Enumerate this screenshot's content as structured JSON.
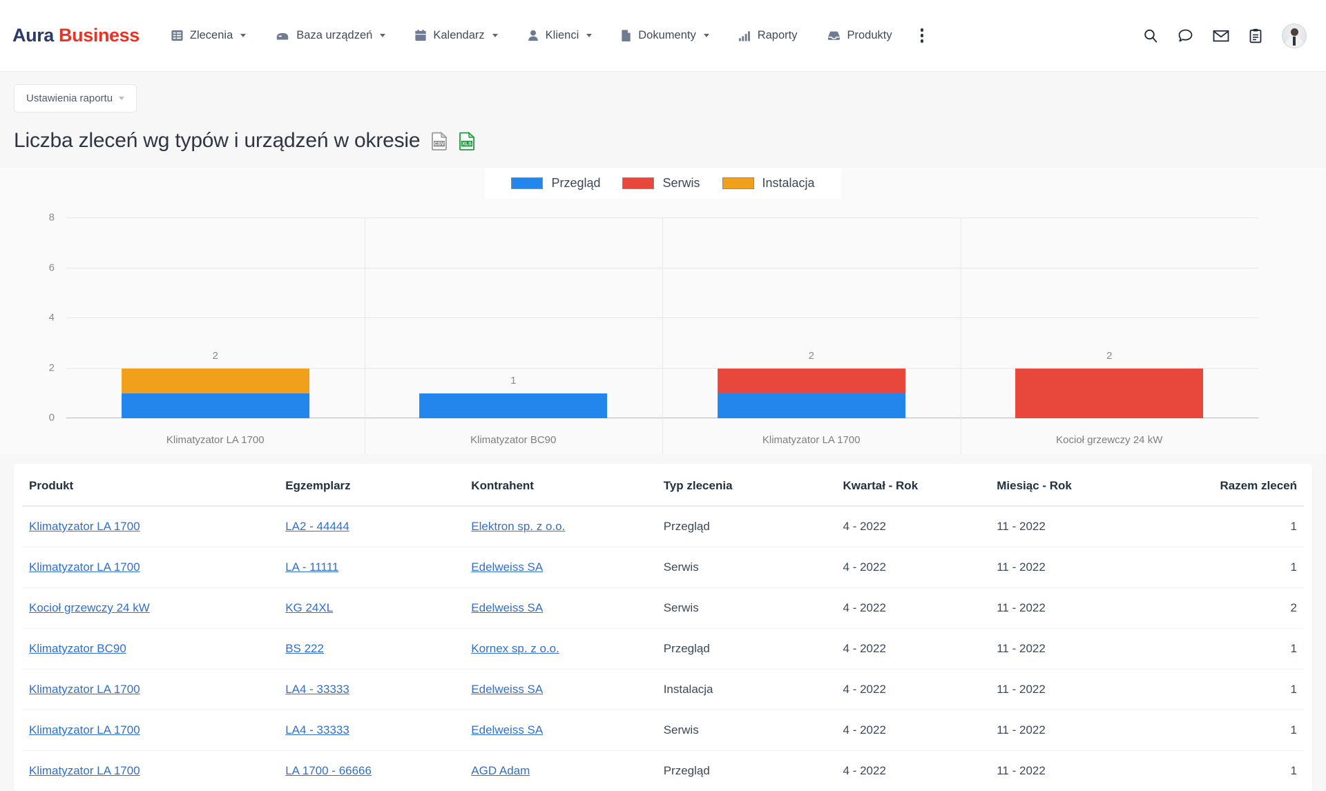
{
  "app": {
    "logo_primary": "Aura",
    "logo_secondary": "Business",
    "logo_primary_color": "#2b3a67",
    "logo_secondary_color": "#ee3124"
  },
  "nav": {
    "items": [
      {
        "label": "Zlecenia",
        "icon": "list-icon",
        "has_caret": true
      },
      {
        "label": "Baza urządzeń",
        "icon": "device-icon",
        "has_caret": true
      },
      {
        "label": "Kalendarz",
        "icon": "calendar-icon",
        "has_caret": true
      },
      {
        "label": "Klienci",
        "icon": "person-icon",
        "has_caret": true
      },
      {
        "label": "Dokumenty",
        "icon": "document-icon",
        "has_caret": true
      },
      {
        "label": "Raporty",
        "icon": "bar-chart-icon",
        "has_caret": false
      },
      {
        "label": "Produkty",
        "icon": "inbox-icon",
        "has_caret": false
      }
    ],
    "overflow_icon": "kebab-menu-icon",
    "right_icons": [
      "search-icon",
      "chat-bubble-icon",
      "envelope-icon",
      "clipboard-icon"
    ],
    "avatar": "user-avatar"
  },
  "toolbar": {
    "report_settings_label": "Ustawienia raportu"
  },
  "report": {
    "title": "Liczba zleceń wg typów i urządzeń w okresie",
    "export_csv_icon": "csv-file-icon",
    "export_xls_icon": "xls-file-icon"
  },
  "chart_data": {
    "type": "bar",
    "stacked": true,
    "title": "Liczba zleceń wg typów i urządzeń w okresie",
    "xlabel": "",
    "ylabel": "",
    "ylim": [
      0,
      8
    ],
    "yticks": [
      0,
      2,
      4,
      6,
      8
    ],
    "grid": true,
    "legend_position": "top-center",
    "categories": [
      "Klimatyzator LA 1700",
      "Klimatyzator BC90",
      "Klimatyzator LA 1700",
      "Kocioł grzewczy 24 kW"
    ],
    "series": [
      {
        "name": "Przegląd",
        "color": "#2286ec",
        "values": [
          1,
          1,
          1,
          0
        ]
      },
      {
        "name": "Serwis",
        "color": "#e8483c",
        "values": [
          0,
          0,
          1,
          2
        ]
      },
      {
        "name": "Instalacja",
        "color": "#f0a01b",
        "values": [
          1,
          0,
          0,
          0
        ]
      }
    ],
    "totals": [
      2,
      1,
      2,
      2
    ]
  },
  "table": {
    "columns": [
      {
        "key": "produkt",
        "label": "Produkt",
        "align": "left"
      },
      {
        "key": "egz",
        "label": "Egzemplarz",
        "align": "left"
      },
      {
        "key": "kontr",
        "label": "Kontrahent",
        "align": "left"
      },
      {
        "key": "typ",
        "label": "Typ zlecenia",
        "align": "left"
      },
      {
        "key": "kwartal",
        "label": "Kwartał - Rok",
        "align": "left"
      },
      {
        "key": "miesiac",
        "label": "Miesiąc - Rok",
        "align": "left"
      },
      {
        "key": "razem",
        "label": "Razem zleceń",
        "align": "right"
      }
    ],
    "rows": [
      {
        "produkt": "Klimatyzator LA 1700",
        "egz": "LA2 - 44444",
        "kontr": "Elektron sp. z o.o.",
        "typ": "Przegląd",
        "kwartal": "4 - 2022",
        "miesiac": "11 - 2022",
        "razem": "1"
      },
      {
        "produkt": "Klimatyzator LA 1700",
        "egz": "LA - 11111",
        "kontr": "Edelweiss SA",
        "typ": "Serwis",
        "kwartal": "4 - 2022",
        "miesiac": "11 - 2022",
        "razem": "1"
      },
      {
        "produkt": "Kocioł grzewczy 24 kW",
        "egz": "KG 24XL",
        "kontr": "Edelweiss SA",
        "typ": "Serwis",
        "kwartal": "4 - 2022",
        "miesiac": "11 - 2022",
        "razem": "2"
      },
      {
        "produkt": "Klimatyzator BC90",
        "egz": "BS 222",
        "kontr": "Kornex sp. z o.o.",
        "typ": "Przegląd",
        "kwartal": "4 - 2022",
        "miesiac": "11 - 2022",
        "razem": "1"
      },
      {
        "produkt": "Klimatyzator LA 1700",
        "egz": "LA4 - 33333",
        "kontr": "Edelweiss SA",
        "typ": "Instalacja",
        "kwartal": "4 - 2022",
        "miesiac": "11 - 2022",
        "razem": "1"
      },
      {
        "produkt": "Klimatyzator LA 1700",
        "egz": "LA4 - 33333",
        "kontr": "Edelweiss SA",
        "typ": "Serwis",
        "kwartal": "4 - 2022",
        "miesiac": "11 - 2022",
        "razem": "1"
      },
      {
        "produkt": "Klimatyzator LA 1700",
        "egz": "LA 1700 - 66666",
        "kontr": "AGD Adam",
        "typ": "Przegląd",
        "kwartal": "4 - 2022",
        "miesiac": "11 - 2022",
        "razem": "1"
      }
    ]
  }
}
